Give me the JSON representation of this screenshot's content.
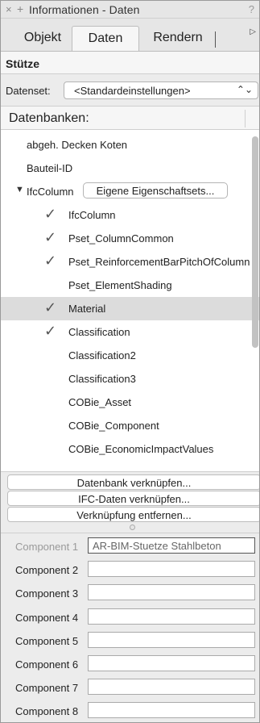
{
  "window": {
    "title": "Informationen - Daten",
    "close_glyph": "×",
    "add_glyph": "+",
    "help_glyph": "?"
  },
  "tabs": [
    {
      "label": "Objekt"
    },
    {
      "label": "Daten",
      "active": true
    },
    {
      "label": "Rendern"
    }
  ],
  "tabs_more_glyph": "▷",
  "object_title": "Stütze",
  "datenset": {
    "label": "Datenset:",
    "value": "<Standardeinstellungen>",
    "chevron": "⌃⌄"
  },
  "databases": {
    "header": "Datenbanken:",
    "items": [
      {
        "label": "abgeh. Decken Koten",
        "level": 0
      },
      {
        "label": "Bauteil-ID",
        "level": 0
      },
      {
        "label": "IfcColumn",
        "level": 0,
        "expanded": true,
        "button": "Eigene Eigenschaftsets..."
      },
      {
        "label": "IfcColumn",
        "level": 1,
        "checked": true
      },
      {
        "label": "Pset_ColumnCommon",
        "level": 1,
        "checked": true
      },
      {
        "label": "Pset_ReinforcementBarPitchOfColumn",
        "level": 1,
        "checked": true
      },
      {
        "label": "Pset_ElementShading",
        "level": 1,
        "checked": false
      },
      {
        "label": "Material",
        "level": 1,
        "checked": true,
        "selected": true
      },
      {
        "label": "Classification",
        "level": 1,
        "checked": true
      },
      {
        "label": "Classification2",
        "level": 1,
        "checked": false
      },
      {
        "label": "Classification3",
        "level": 1,
        "checked": false
      },
      {
        "label": "COBie_Asset",
        "level": 1,
        "checked": false
      },
      {
        "label": "COBie_Component",
        "level": 1,
        "checked": false
      },
      {
        "label": "COBie_EconomicImpactValues",
        "level": 1,
        "checked": false
      }
    ],
    "check_glyph": "✓",
    "expanded_glyph": "▼"
  },
  "actions": {
    "link_db": "Datenbank verknüpfen...",
    "link_ifc": "IFC-Daten verknüpfen...",
    "remove_link": "Verknüpfung entfernen..."
  },
  "fields": [
    {
      "label": "Component 1",
      "value": "AR-BIM-Stuetze Stahlbeton",
      "dim": true,
      "active": true
    },
    {
      "label": "Component 2",
      "value": ""
    },
    {
      "label": "Component 3",
      "value": ""
    },
    {
      "label": "Component 4",
      "value": ""
    },
    {
      "label": "Component 5",
      "value": ""
    },
    {
      "label": "Component 6",
      "value": ""
    },
    {
      "label": "Component 7",
      "value": ""
    },
    {
      "label": "Component 8",
      "value": ""
    }
  ]
}
